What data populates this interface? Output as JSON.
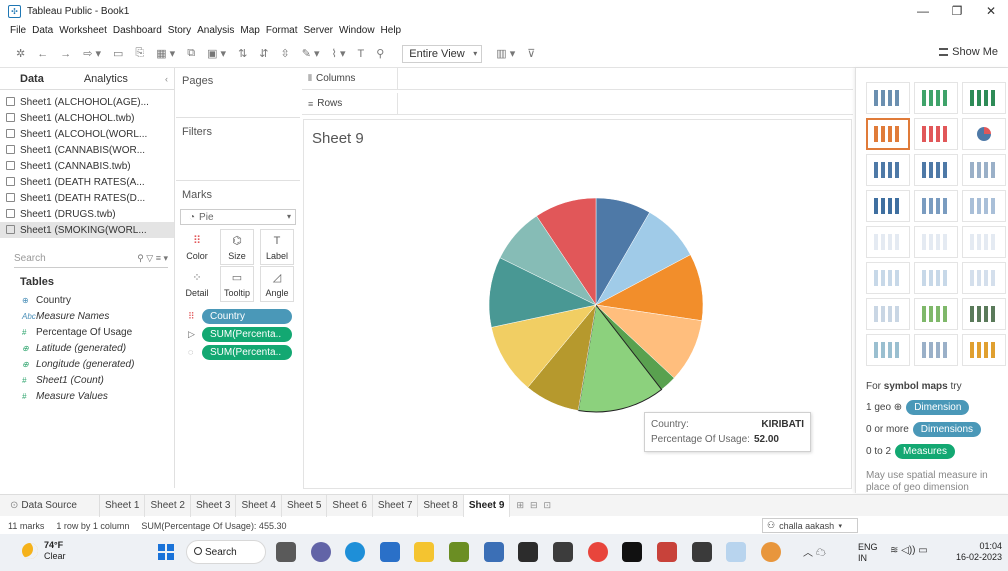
{
  "window": {
    "title": "Tableau Public - Book1",
    "controls": [
      "—",
      "❐",
      "✕"
    ]
  },
  "menu": [
    "File",
    "Data",
    "Worksheet",
    "Dashboard",
    "Story",
    "Analysis",
    "Map",
    "Format",
    "Server",
    "Window",
    "Help"
  ],
  "toolbar": {
    "view_select": "Entire View",
    "show_me_label": "Show Me"
  },
  "data_pane": {
    "tab_data": "Data",
    "tab_analytics": "Analytics",
    "sources": [
      "Sheet1 (ALCHOHOL(AGE)...",
      "Sheet1 (ALCHOHOL.twb)",
      "Sheet1 (ALCOHOL(WORL...",
      "Sheet1 (CANNABIS(WOR...",
      "Sheet1 (CANNABIS.twb)",
      "Sheet1 (DEATH RATES(A...",
      "Sheet1 (DEATH RATES(D...",
      "Sheet1 (DRUGS.twb)",
      "Sheet1 (SMOKING(WORL..."
    ],
    "selected_source_index": 8,
    "search_placeholder": "Search",
    "tables_heading": "Tables",
    "fields": [
      {
        "type_icon": "⊕",
        "name": "Country",
        "kind": "dimension",
        "italic": false
      },
      {
        "type_icon": "Abc",
        "name": "Measure Names",
        "kind": "dimension",
        "italic": true
      },
      {
        "type_icon": "#",
        "name": "Percentage Of Usage",
        "kind": "measure",
        "italic": false
      },
      {
        "type_icon": "⊕",
        "name": "Latitude (generated)",
        "kind": "measure",
        "italic": true
      },
      {
        "type_icon": "⊕",
        "name": "Longitude (generated)",
        "kind": "measure",
        "italic": true
      },
      {
        "type_icon": "#",
        "name": "Sheet1 (Count)",
        "kind": "measure",
        "italic": true
      },
      {
        "type_icon": "#",
        "name": "Measure Values",
        "kind": "measure",
        "italic": true
      }
    ]
  },
  "shelves": {
    "pages": "Pages",
    "filters": "Filters",
    "marks": "Marks",
    "columns": "Columns",
    "rows": "Rows"
  },
  "marks_card": {
    "mark_type": "Pie",
    "buttons": [
      "Color",
      "Size",
      "Label",
      "Detail",
      "Tooltip",
      "Angle"
    ],
    "pills": [
      {
        "icon": "⠿",
        "label": "Country",
        "kind": "dimension"
      },
      {
        "icon": "▷",
        "label": "SUM(Percenta..",
        "kind": "measure"
      },
      {
        "icon": "◌",
        "label": "SUM(Percenta..",
        "kind": "measure"
      }
    ]
  },
  "sheet": {
    "title": "Sheet 9",
    "tooltip": {
      "country_label": "Country:",
      "country_value": "KIRIBATI",
      "usage_label": "Percentage Of Usage:",
      "usage_value": "52.00"
    }
  },
  "chart_data": {
    "type": "pie",
    "title": "Sheet 9",
    "slices": [
      {
        "value": 33,
        "color": "#4e79a7"
      },
      {
        "value": 35,
        "color": "#a0cbe8"
      },
      {
        "value": 40,
        "color": "#f28e2b"
      },
      {
        "value": 38,
        "color": "#ffbe7d"
      },
      {
        "value": 10,
        "color": "#59a14f"
      },
      {
        "value": 52,
        "color": "#8cd17d"
      },
      {
        "value": 33,
        "color": "#b6992d"
      },
      {
        "value": 42,
        "color": "#f1ce63"
      },
      {
        "value": 42,
        "color": "#499894"
      },
      {
        "value": 33,
        "color": "#86bcb6"
      },
      {
        "value": 37,
        "color": "#e15759"
      }
    ],
    "total": 455.3,
    "highlighted_value": 52.0
  },
  "show_me": {
    "tiles_selected_index": 3,
    "hint_prefix": "For",
    "hint_bold": "symbol maps",
    "hint_suffix": "try",
    "line1_text": "1 geo ⊕",
    "line1_badge": "Dimension",
    "line2_text": "0 or more",
    "line2_badge": "Dimensions",
    "line3_text": "0 to 2",
    "line3_badge": "Measures",
    "note": "May use spatial measure in place of geo dimension"
  },
  "tabs": {
    "data_source": "Data Source",
    "sheets": [
      "Sheet 1",
      "Sheet 2",
      "Sheet 3",
      "Sheet 4",
      "Sheet 5",
      "Sheet 6",
      "Sheet 7",
      "Sheet 8",
      "Sheet 9"
    ],
    "active_index": 8
  },
  "status": {
    "marks": "11 marks",
    "rows_cols": "1 row by 1 column",
    "sum": "SUM(Percentage Of Usage): 455.30",
    "user": "challa aakash"
  },
  "taskbar": {
    "temp": "74°F",
    "weather": "Clear",
    "search": "Search",
    "lang1": "ENG",
    "lang2": "IN",
    "time": "01:04",
    "date": "16-02-2023"
  }
}
